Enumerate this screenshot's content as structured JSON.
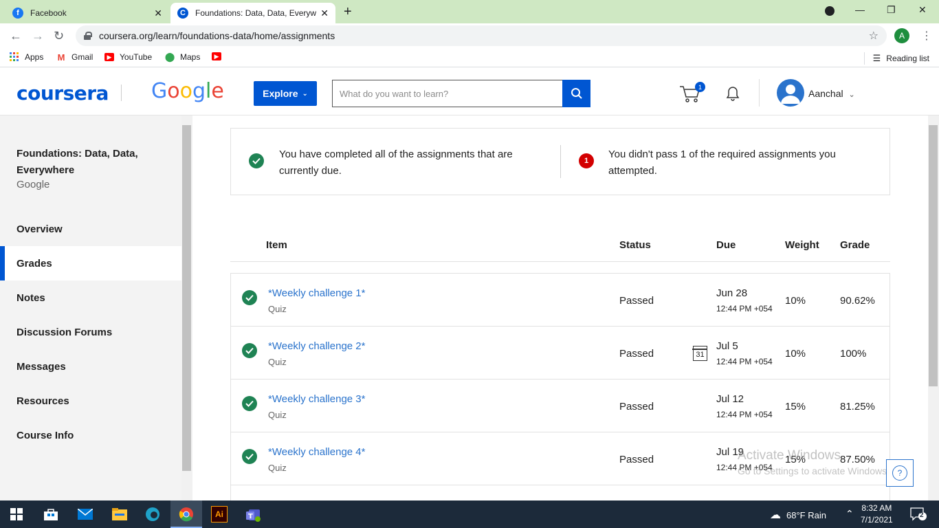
{
  "browser": {
    "tabs": [
      {
        "title": "Facebook",
        "favicon": "facebook-icon"
      },
      {
        "title": "Foundations: Data, Data, Everywh",
        "favicon": "coursera-icon"
      }
    ],
    "url": "coursera.org/learn/foundations-data/home/assignments",
    "profile_initial": "A",
    "bookmarks": [
      {
        "label": "Apps",
        "icon": "apps-grid-icon"
      },
      {
        "label": "Gmail",
        "icon": "gmail-icon"
      },
      {
        "label": "YouTube",
        "icon": "youtube-icon"
      },
      {
        "label": "Maps",
        "icon": "maps-icon"
      },
      {
        "label": "",
        "icon": "youtube-icon"
      }
    ],
    "reading_list": "Reading list"
  },
  "header": {
    "logo": "coursera",
    "partner_logo": "Google",
    "explore_label": "Explore",
    "search_placeholder": "What do you want to learn?",
    "cart_count": "1",
    "username": "Aanchal"
  },
  "sidebar": {
    "course_title": "Foundations: Data, Data, Everywhere",
    "course_org": "Google",
    "items": [
      {
        "label": "Overview",
        "active": false
      },
      {
        "label": "Grades",
        "active": true
      },
      {
        "label": "Notes",
        "active": false
      },
      {
        "label": "Discussion Forums",
        "active": false
      },
      {
        "label": "Messages",
        "active": false
      },
      {
        "label": "Resources",
        "active": false
      },
      {
        "label": "Course Info",
        "active": false
      }
    ]
  },
  "alerts": {
    "completed": "You have completed all of the assignments that are currently due.",
    "failed_count": "1",
    "failed": "You didn't pass 1 of the required assignments you attempted."
  },
  "table": {
    "columns": [
      "Item",
      "Status",
      "Due",
      "Weight",
      "Grade"
    ],
    "rows": [
      {
        "name": "*Weekly challenge 1*",
        "type": "Quiz",
        "status": "Passed",
        "due_date": "Jun 28",
        "due_time": "12:44 PM +054",
        "weight": "10%",
        "grade": "90.62%"
      },
      {
        "name": "*Weekly challenge 2*",
        "type": "Quiz",
        "status": "Passed",
        "due_date": "Jul 5",
        "due_time": "12:44 PM +054",
        "weight": "10%",
        "grade": "100%",
        "calendar": "31"
      },
      {
        "name": "*Weekly challenge 3*",
        "type": "Quiz",
        "status": "Passed",
        "due_date": "Jul 12",
        "due_time": "12:44 PM +054",
        "weight": "15%",
        "grade": "81.25%"
      },
      {
        "name": "*Weekly challenge 4*",
        "type": "Quiz",
        "status": "Passed",
        "due_date": "Jul 19",
        "due_time": "12:44 PM +054",
        "weight": "15%",
        "grade": "87.50%"
      }
    ]
  },
  "watermark": {
    "line1": "Activate Windows",
    "line2": "Go to Settings to activate Windows."
  },
  "taskbar": {
    "weather": "68°F  Rain",
    "time": "8:32 AM",
    "date": "7/1/2021",
    "notifications": "2"
  },
  "colors": {
    "accent": "#0056d2",
    "success": "#1f8354",
    "error": "#d30001",
    "link": "#2a73cc"
  }
}
